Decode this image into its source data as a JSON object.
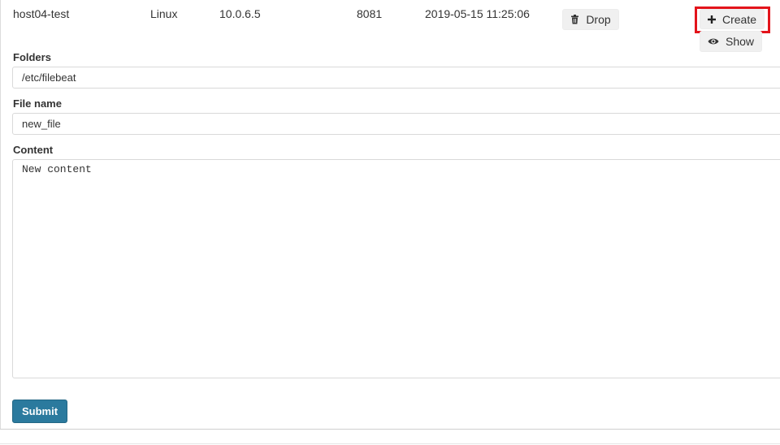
{
  "host_row": {
    "hostname": "host04-test",
    "os": "Linux",
    "ip": "10.0.6.5",
    "port": "8081",
    "date": "2019-05-15 11:25:06",
    "drop_label": "Drop",
    "create_label": "Create",
    "show_label": "Show"
  },
  "form": {
    "folders_label": "Folders",
    "folders_value": "/etc/filebeat",
    "filename_label": "File name",
    "filename_value": "new_file",
    "content_label": "Content",
    "content_value": "New content",
    "submit_label": "Submit"
  },
  "icons": {
    "drop": "trash-icon",
    "create": "plus-icon",
    "show": "eye-icon"
  },
  "colors": {
    "submit_bg": "#2b7a9e",
    "highlight": "#e3141b"
  }
}
